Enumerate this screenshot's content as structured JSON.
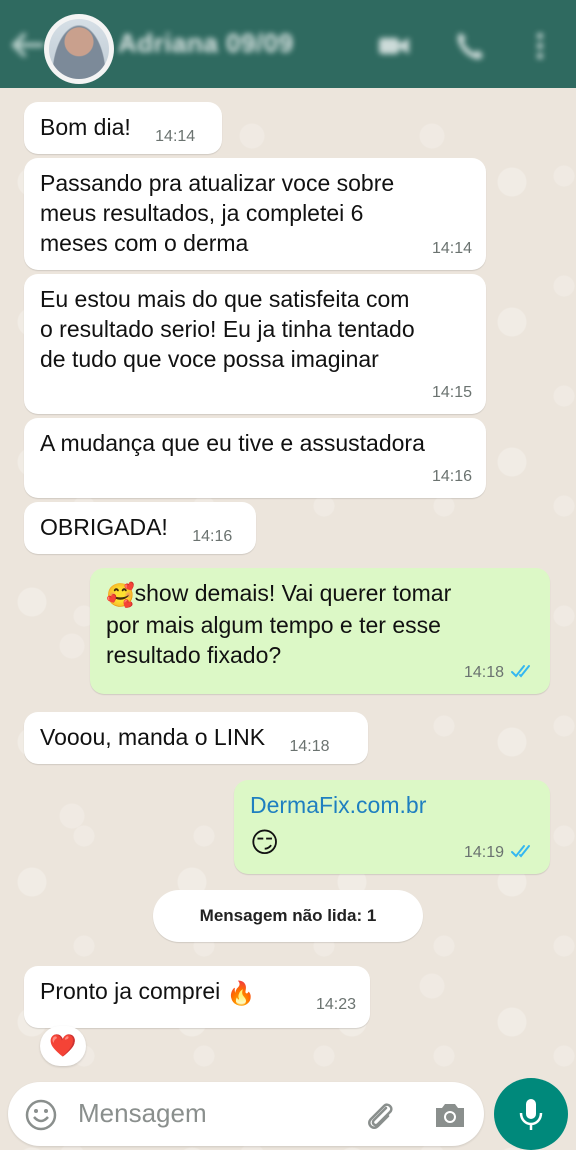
{
  "header": {
    "contact_name": "Adriana 09/09",
    "icons": [
      "back-arrow-icon",
      "avatar",
      "video-call-icon",
      "voice-call-icon",
      "more-options-icon"
    ]
  },
  "messages": [
    {
      "dir": "in",
      "text": "Bom dia!",
      "time": "14:14"
    },
    {
      "dir": "in",
      "text": "Passando pra atualizar voce sobre\nmeus resultados, ja completei 6\nmeses com o derma",
      "time": "14:14"
    },
    {
      "dir": "in",
      "text": "Eu estou mais do que satisfeita com\no resultado serio! Eu ja tinha tentado\nde tudo que voce possa imaginar",
      "time": "14:15"
    },
    {
      "dir": "in",
      "text": "A mudança que eu tive e assustadora",
      "time": "14:16"
    },
    {
      "dir": "in",
      "text": "OBRIGADA!",
      "time": "14:16"
    },
    {
      "dir": "out",
      "emoji": "🥰",
      "text": "show demais! Vai querer tomar\npor mais algum tempo e ter esse\nresultado fixado?",
      "time": "14:18",
      "status": "read"
    },
    {
      "dir": "in",
      "text": "Vooou, manda o LINK",
      "time": "14:18"
    },
    {
      "dir": "out",
      "link": "DermaFix.com.br",
      "emoji": "😏",
      "time": "14:19",
      "status": "read"
    },
    {
      "dir": "in",
      "text": "Pronto ja comprei ",
      "emoji": "🔥",
      "time": "14:23",
      "reaction": "❤️"
    }
  ],
  "unread_label": "Mensagem não lida: 1",
  "input": {
    "placeholder": "Mensagem"
  },
  "colors": {
    "header": "#2f6a60",
    "outgoing": "#dcf8c6",
    "incoming": "#ffffff",
    "mic": "#00897b",
    "read_ticks": "#34b7f1"
  }
}
